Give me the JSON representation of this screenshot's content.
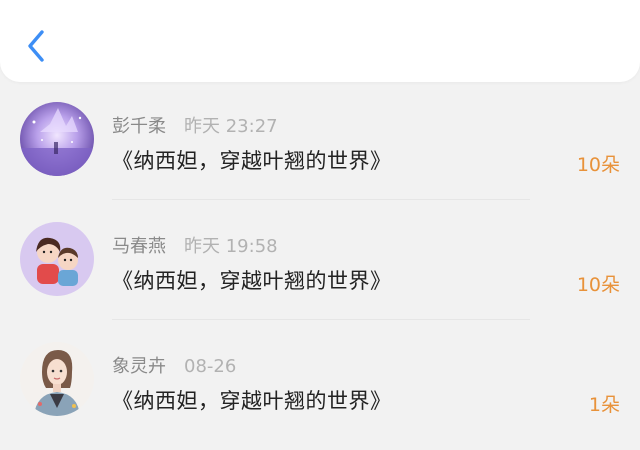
{
  "header": {
    "back_icon": "chevron-left-icon",
    "accent": "#3d8ef5"
  },
  "records": [
    {
      "name": "彭千柔",
      "time": "昨天 23:27",
      "title": "《纳西妲，穿越叶翘的世界》",
      "amount": "10朵",
      "avatar": "purple-galaxy-avatar"
    },
    {
      "name": "马春燕",
      "time": "昨天 19:58",
      "title": "《纳西妲，穿越叶翘的世界》",
      "amount": "10朵",
      "avatar": "cartoon-couple-avatar"
    },
    {
      "name": "象灵卉",
      "time": "08-26",
      "title": "《纳西妲，穿越叶翘的世界》",
      "amount": "1朵",
      "avatar": "illustrated-girl-avatar"
    }
  ],
  "colors": {
    "amount": "#e8923a",
    "background": "#f2f2f2"
  }
}
